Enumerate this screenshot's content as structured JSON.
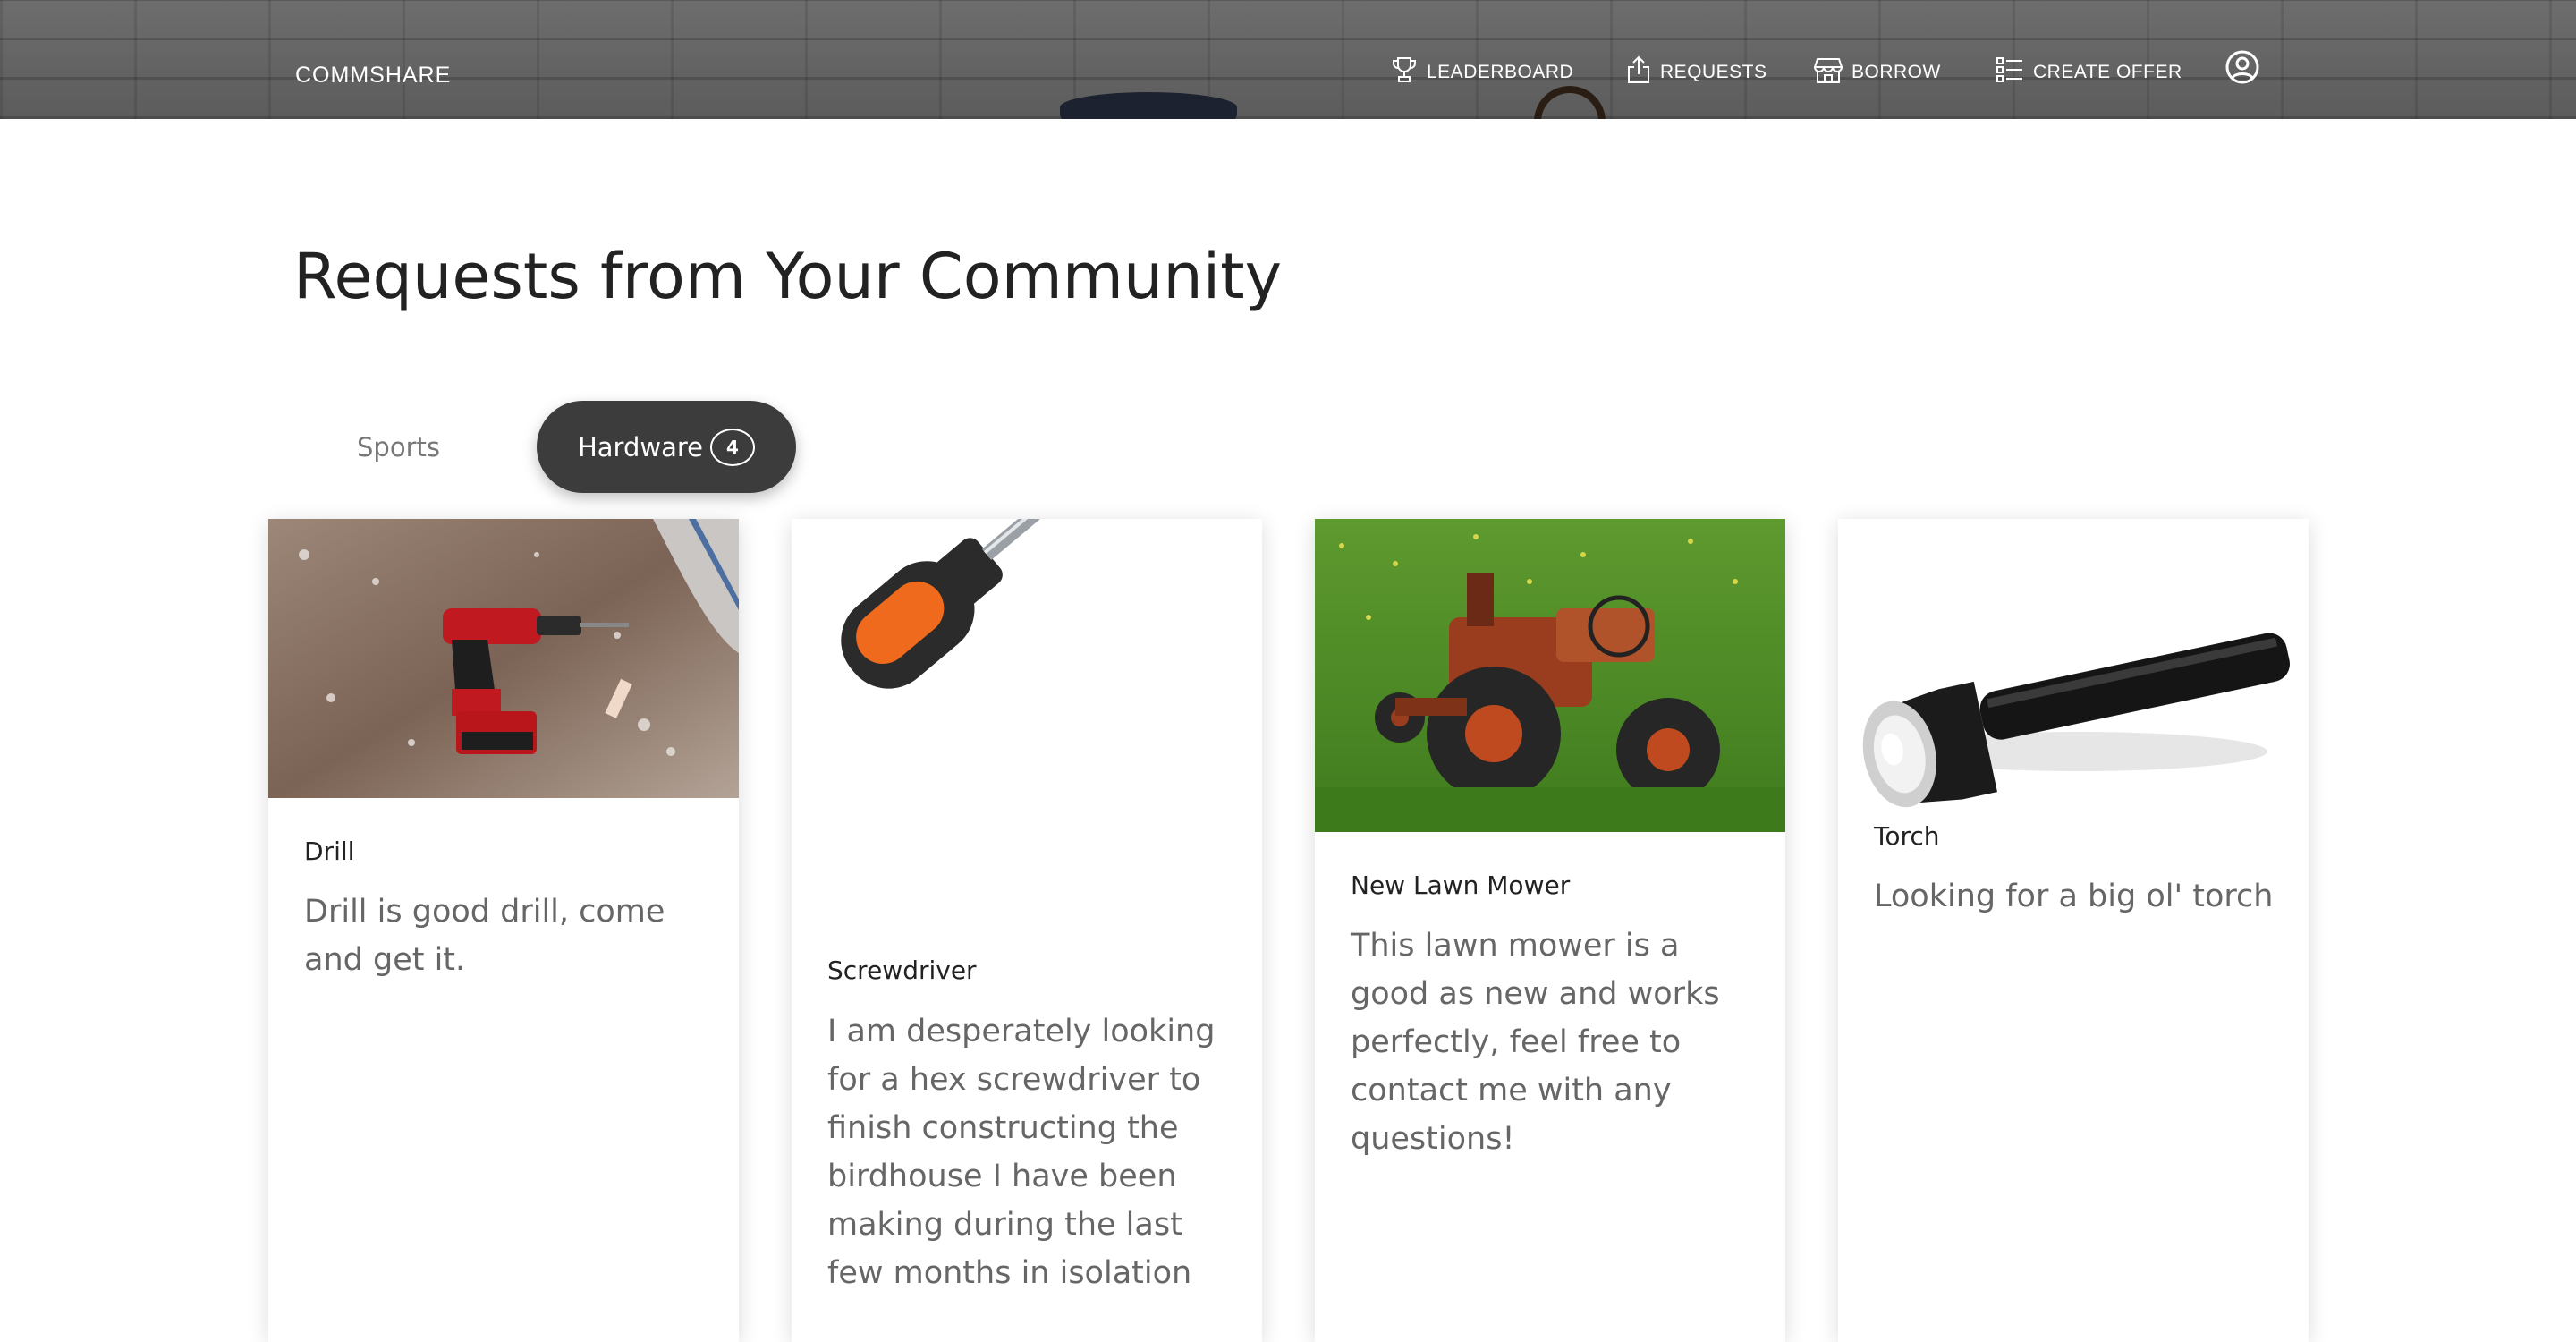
{
  "header": {
    "brand": "COMMSHARE",
    "nav": [
      {
        "label": "LEADERBOARD",
        "icon": "trophy-icon"
      },
      {
        "label": "REQUESTS",
        "icon": "share-icon"
      },
      {
        "label": "BORROW",
        "icon": "store-icon"
      },
      {
        "label": "CREATE OFFER",
        "icon": "list-icon"
      }
    ],
    "profile_icon": "user-circle-icon"
  },
  "page": {
    "title": "Requests from Your Community"
  },
  "tabs": [
    {
      "label": "Sports",
      "active": false
    },
    {
      "label": "Hardware",
      "active": true,
      "count": "4"
    }
  ],
  "cards": [
    {
      "name": "Drill",
      "description": "Drill is good drill, come and get it.",
      "image": "drill-image"
    },
    {
      "name": "Screwdriver",
      "description": "I am desperately looking for a hex screwdriver to finish constructing the birdhouse I have been making during the last few months in isolation",
      "image": "screwdriver-image"
    },
    {
      "name": "New Lawn Mower",
      "description": "This lawn mower is a good as new and works perfectly, feel free to contact me with any questions!",
      "image": "tractor-image"
    },
    {
      "name": "Torch",
      "description": "Looking for a big ol' torch",
      "image": "torch-image"
    }
  ],
  "colors": {
    "active_tab": "#3c3c3c",
    "inactive_tab_text": "#777777",
    "title": "#222222",
    "description": "#666666"
  }
}
